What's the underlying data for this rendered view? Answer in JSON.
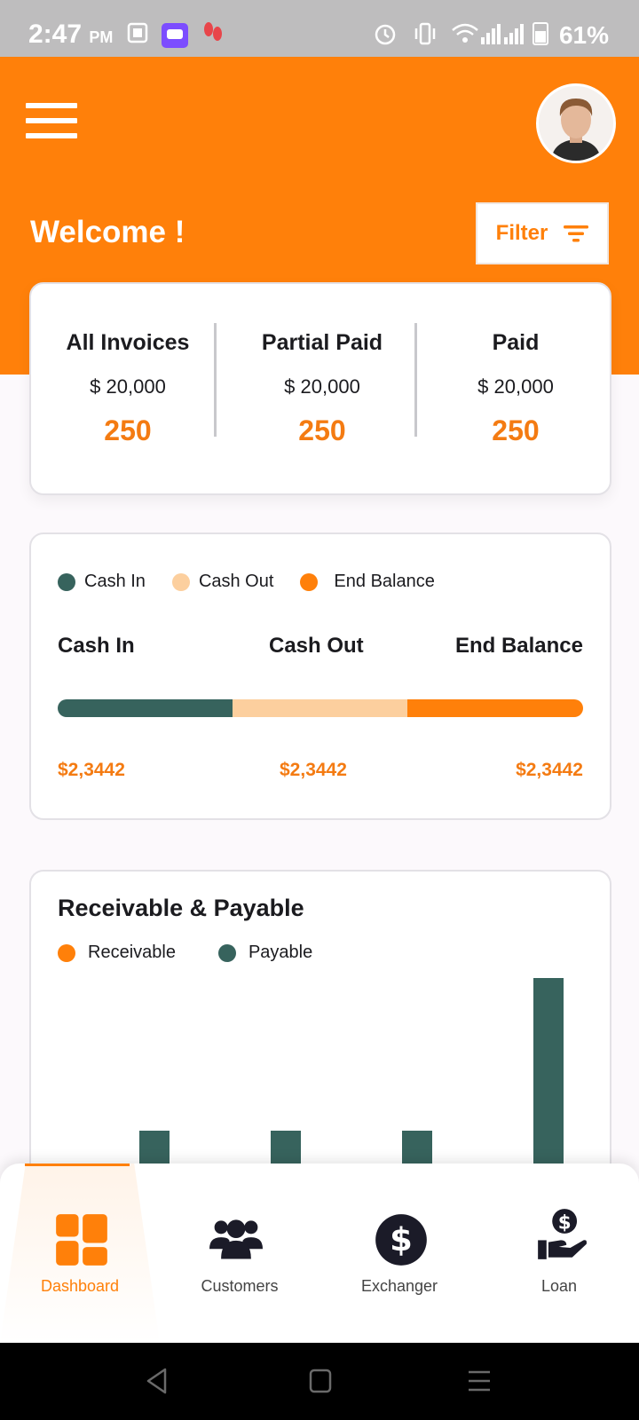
{
  "status_bar": {
    "time": "2:47",
    "ampm": "PM",
    "battery": "61%"
  },
  "header": {
    "welcome": "Welcome !",
    "filter_label": "Filter"
  },
  "invoices": [
    {
      "title": "All Invoices",
      "amount": "$ 20,000",
      "count": "250"
    },
    {
      "title": "Partial Paid",
      "amount": "$ 20,000",
      "count": "250"
    },
    {
      "title": "Paid",
      "amount": "$ 20,000",
      "count": "250"
    }
  ],
  "cash": {
    "legend": [
      {
        "label": "Cash In",
        "color": "#37635d"
      },
      {
        "label": "Cash Out",
        "color": "#fccf9e"
      },
      {
        "label": "End Balance",
        "color": "#ff800a"
      }
    ],
    "headings": [
      "Cash In",
      "Cash Out",
      "End Balance"
    ],
    "values": [
      "$2,3442",
      "$2,3442",
      "$2,3442"
    ],
    "bar_fractions": [
      0.333,
      0.333,
      0.334
    ]
  },
  "receivable_payable": {
    "title": "Receivable & Payable",
    "legend": [
      {
        "label": "Receivable",
        "color": "#ff800a"
      },
      {
        "label": "Payable",
        "color": "#37635d"
      }
    ]
  },
  "chart_data": {
    "type": "bar",
    "title": "Receivable & Payable",
    "series": [
      {
        "name": "Payable",
        "color": "#37635d",
        "values": [
          1,
          1,
          1,
          3
        ]
      }
    ],
    "note_visible": "chart partially hidden behind bottom navigation; only bar tops visible"
  },
  "nav": {
    "items": [
      {
        "label": "Dashboard",
        "icon": "dashboard-icon",
        "active": true
      },
      {
        "label": "Customers",
        "icon": "customers-icon",
        "active": false
      },
      {
        "label": "Exchanger",
        "icon": "dollar-coin-icon",
        "active": false
      },
      {
        "label": "Loan",
        "icon": "loan-icon",
        "active": false
      }
    ],
    "active_color": "#ff800a"
  }
}
